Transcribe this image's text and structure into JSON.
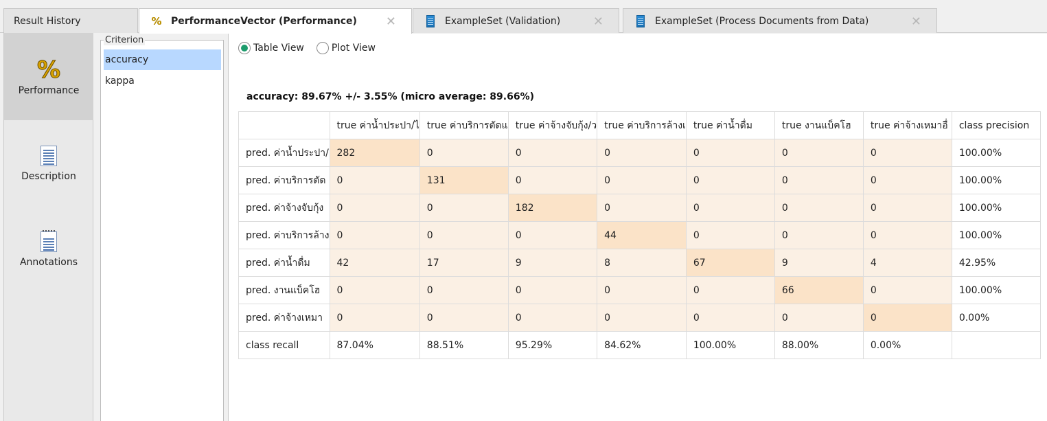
{
  "tabs": [
    {
      "label": "Result History",
      "icon": "none",
      "active": false
    },
    {
      "label": "PerformanceVector (Performance)",
      "icon": "percent-icon",
      "active": true
    },
    {
      "label": "ExampleSet (Validation)",
      "icon": "exampleset-icon",
      "active": false
    },
    {
      "label": "ExampleSet (Process Documents from Data)",
      "icon": "exampleset-icon",
      "active": false
    }
  ],
  "sidebar": {
    "items": [
      {
        "label": "Performance",
        "icon": "percent-icon"
      },
      {
        "label": "Description",
        "icon": "document-icon"
      },
      {
        "label": "Annotations",
        "icon": "annotations-icon"
      }
    ]
  },
  "criterion": {
    "title": "Criterion",
    "items": [
      "accuracy",
      "kappa"
    ]
  },
  "views": {
    "table": "Table View",
    "plot": "Plot View",
    "selected": "Table View"
  },
  "summary": "accuracy: 89.67% +/- 3.55% (micro average: 89.66%)",
  "matrix": {
    "headers": [
      "",
      "true ค่าน้ำประปา/ไ",
      "true ค่าบริการตัดแ",
      "true ค่าจ้างจับกุ้ง/ว",
      "true ค่าบริการล้างเ",
      "true ค่าน้ำดื่ม",
      "true งานแบ็คโฮ",
      "true ค่าจ้างเหมาอื่",
      "class precision"
    ],
    "rows": [
      [
        "pred. ค่าน้ำประปา/",
        "282",
        "0",
        "0",
        "0",
        "0",
        "0",
        "0",
        "100.00%"
      ],
      [
        "pred. ค่าบริการตัด",
        "0",
        "131",
        "0",
        "0",
        "0",
        "0",
        "0",
        "100.00%"
      ],
      [
        "pred. ค่าจ้างจับกุ้ง",
        "0",
        "0",
        "182",
        "0",
        "0",
        "0",
        "0",
        "100.00%"
      ],
      [
        "pred. ค่าบริการล้าง",
        "0",
        "0",
        "0",
        "44",
        "0",
        "0",
        "0",
        "100.00%"
      ],
      [
        "pred. ค่าน้ำดื่ม",
        "42",
        "17",
        "9",
        "8",
        "67",
        "9",
        "4",
        "42.95%"
      ],
      [
        "pred. งานแบ็คโฮ",
        "0",
        "0",
        "0",
        "0",
        "0",
        "66",
        "0",
        "100.00%"
      ],
      [
        "pred. ค่าจ้างเหมา",
        "0",
        "0",
        "0",
        "0",
        "0",
        "0",
        "0",
        "0.00%"
      ]
    ],
    "recall_row": [
      "class recall",
      "87.04%",
      "88.51%",
      "95.29%",
      "84.62%",
      "100.00%",
      "88.00%",
      "0.00%",
      ""
    ]
  },
  "colors": {
    "selected_criterion": "#b8d8ff",
    "cell": "#fbf0e4",
    "diagonal": "#fbe3c8",
    "radio_checked": "#1c9c6c",
    "percent_icon": "#d8a200"
  }
}
